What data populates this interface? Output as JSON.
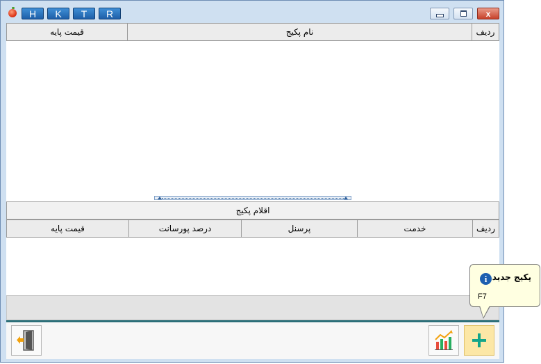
{
  "titlebar": {
    "shortcut_buttons": [
      "H",
      "K",
      "T",
      "R"
    ],
    "close_glyph": "x"
  },
  "packages_grid": {
    "columns": {
      "row": "ردیف",
      "name": "نام پکیج",
      "base_price": "قیمت پایه"
    }
  },
  "items_grid": {
    "title": "اقلام پکیج",
    "columns": {
      "row": "ردیف",
      "service": "خدمت",
      "personnel": "پرسنل",
      "commission": "درصد پورسانت",
      "base_price": "قیمت پایه"
    }
  },
  "toolbar": {
    "buttons": [
      "exit-door-icon",
      "chart-icon",
      "plus-icon"
    ]
  },
  "tooltip": {
    "title": "پکیج جدید",
    "shortcut": "F7",
    "icon": "info-icon"
  },
  "colors": {
    "titlebar": "#cfe0f1",
    "shortcut_button": "#1e5fa8",
    "accent_line": "#2c6f79",
    "add_button_bg": "#fce7a6",
    "plus": "#13a58a",
    "tooltip_bg": "#ffffe1"
  }
}
